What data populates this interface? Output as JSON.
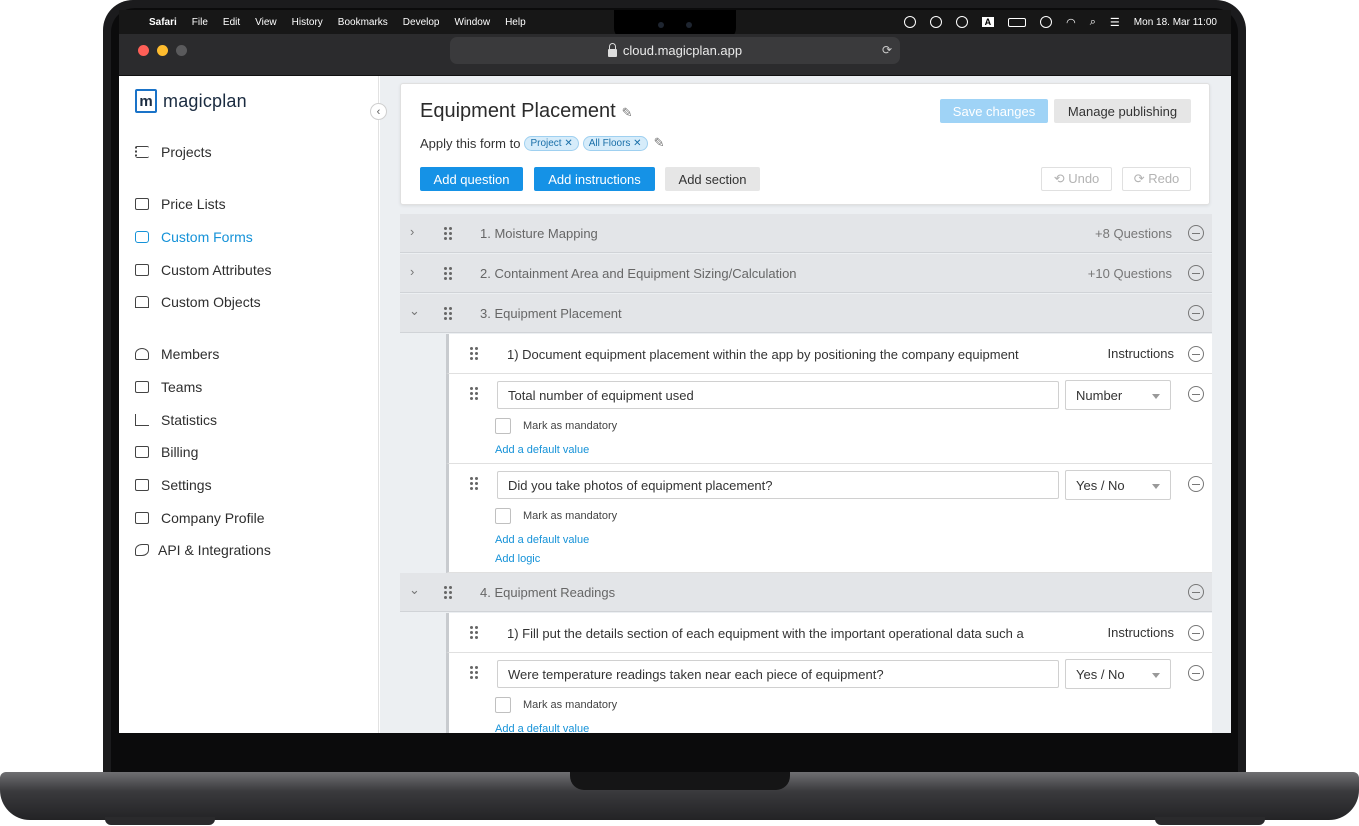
{
  "menubar": {
    "apple": "",
    "items": [
      "Safari",
      "File",
      "Edit",
      "View",
      "History",
      "Bookmarks",
      "Develop",
      "Window",
      "Help"
    ],
    "clock": "Mon 18. Mar  11:00"
  },
  "browser": {
    "url": "cloud.magicplan.app"
  },
  "sidebar": {
    "logo_letter": "m",
    "logo_text": "magicplan",
    "items": [
      {
        "label": "Projects"
      },
      {
        "label": "Price Lists"
      },
      {
        "label": "Custom Forms"
      },
      {
        "label": "Custom Attributes"
      },
      {
        "label": "Custom Objects"
      },
      {
        "label": "Members"
      },
      {
        "label": "Teams"
      },
      {
        "label": "Statistics"
      },
      {
        "label": "Billing"
      },
      {
        "label": "Settings"
      },
      {
        "label": "Company Profile"
      },
      {
        "label": "API & Integrations"
      }
    ]
  },
  "form": {
    "title": "Equipment Placement",
    "apply_label": "Apply this form to",
    "chips": [
      "Project ✕",
      "All Floors ✕"
    ],
    "save_label": "Save changes",
    "publish_label": "Manage publishing",
    "add_question": "Add question",
    "add_instructions": "Add instructions",
    "add_section": "Add section",
    "undo": "⟲ Undo",
    "redo": "⟳ Redo"
  },
  "sections": [
    {
      "title": "1. Moisture Mapping",
      "count": "+8 Questions"
    },
    {
      "title": "2. Containment Area and Equipment Sizing/Calculation",
      "count": "+10 Questions"
    },
    {
      "title": "3. Equipment Placement",
      "count": ""
    },
    {
      "title": "4. Equipment Readings",
      "count": ""
    }
  ],
  "section3": {
    "instruction_text": "1) Document equipment placement within the app by positioning the company equipment",
    "instruction_tag": "Instructions",
    "q1": {
      "value": "Total number of equipment used",
      "type": "Number",
      "mandatory": "Mark as mandatory",
      "default": "Add a default value"
    },
    "q2": {
      "value": "Did you take photos of equipment placement?",
      "type": "Yes / No",
      "mandatory": "Mark as mandatory",
      "default": "Add a default value",
      "logic": "Add logic"
    }
  },
  "section4": {
    "instruction_text": "1) Fill put the details section of each equipment with the important operational data such a",
    "instruction_tag": "Instructions",
    "q1": {
      "value": "Were temperature readings taken near each piece of equipment?",
      "type": "Yes / No",
      "mandatory": "Mark as mandatory",
      "default": "Add a default value"
    }
  },
  "colors": {
    "accent": "#1592e6",
    "active_nav": "#1592d8"
  }
}
